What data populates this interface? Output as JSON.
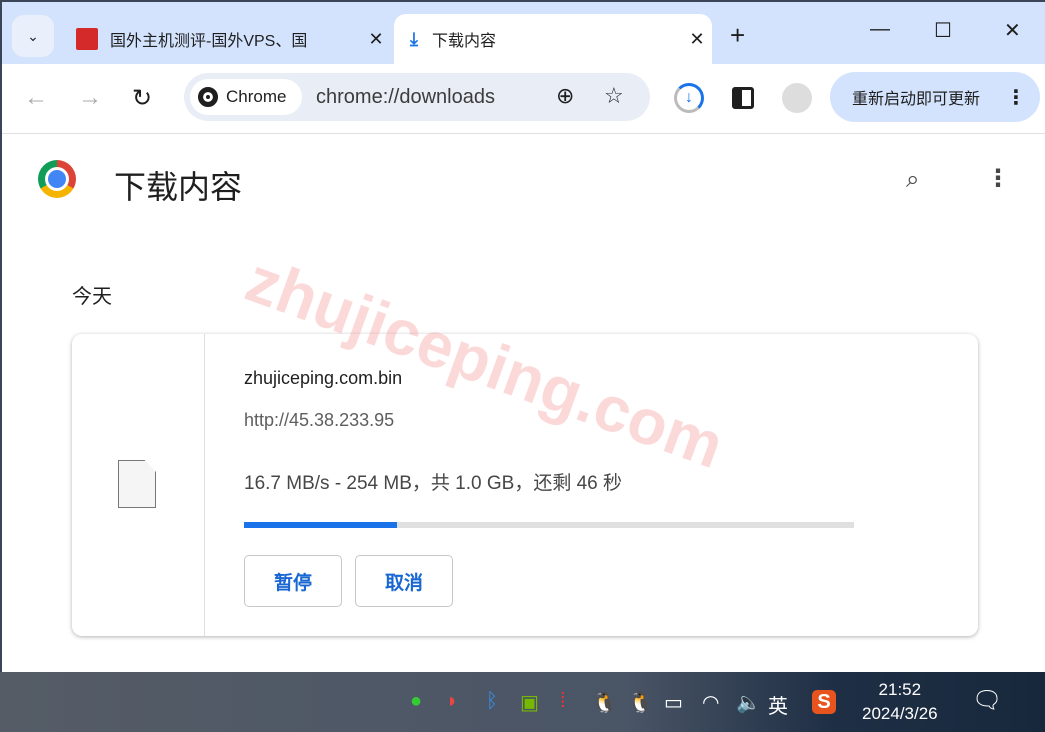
{
  "tabs": [
    {
      "title": "国外主机测评-国外VPS、国",
      "close": "✕"
    },
    {
      "title": "下载内容",
      "close": "✕",
      "icon": "download-icon"
    }
  ],
  "tab_list": "⌄",
  "new_tab": "+",
  "window_controls": {
    "minimize": "—",
    "maximize": "☐",
    "close": "✕"
  },
  "nav": {
    "back": "←",
    "forward": "→",
    "reload": "↻"
  },
  "omnibox": {
    "chip": "Chrome",
    "url": "chrome://downloads",
    "zoom": "⊕",
    "star": "☆"
  },
  "update_button": "重新启动即可更新",
  "update_more": "⋮",
  "page": {
    "title": "下载内容",
    "search": "🔍",
    "more": "⋮",
    "section": "今天"
  },
  "download": {
    "filename": "zhujiceping.com.bin",
    "url": "http://45.38.233.95",
    "status": "16.7 MB/s - 254 MB，共 1.0 GB，还剩 46 秒",
    "progress_percent": 25,
    "pause": "暂停",
    "cancel": "取消"
  },
  "watermark": "zhujiceping.com",
  "colors": {
    "accent": "#1a73e8",
    "tabbar": "#d3e3fd"
  },
  "taskbar": {
    "ime": "英",
    "time": "21:52",
    "date": "2024/3/26",
    "notifications": "🗨"
  }
}
